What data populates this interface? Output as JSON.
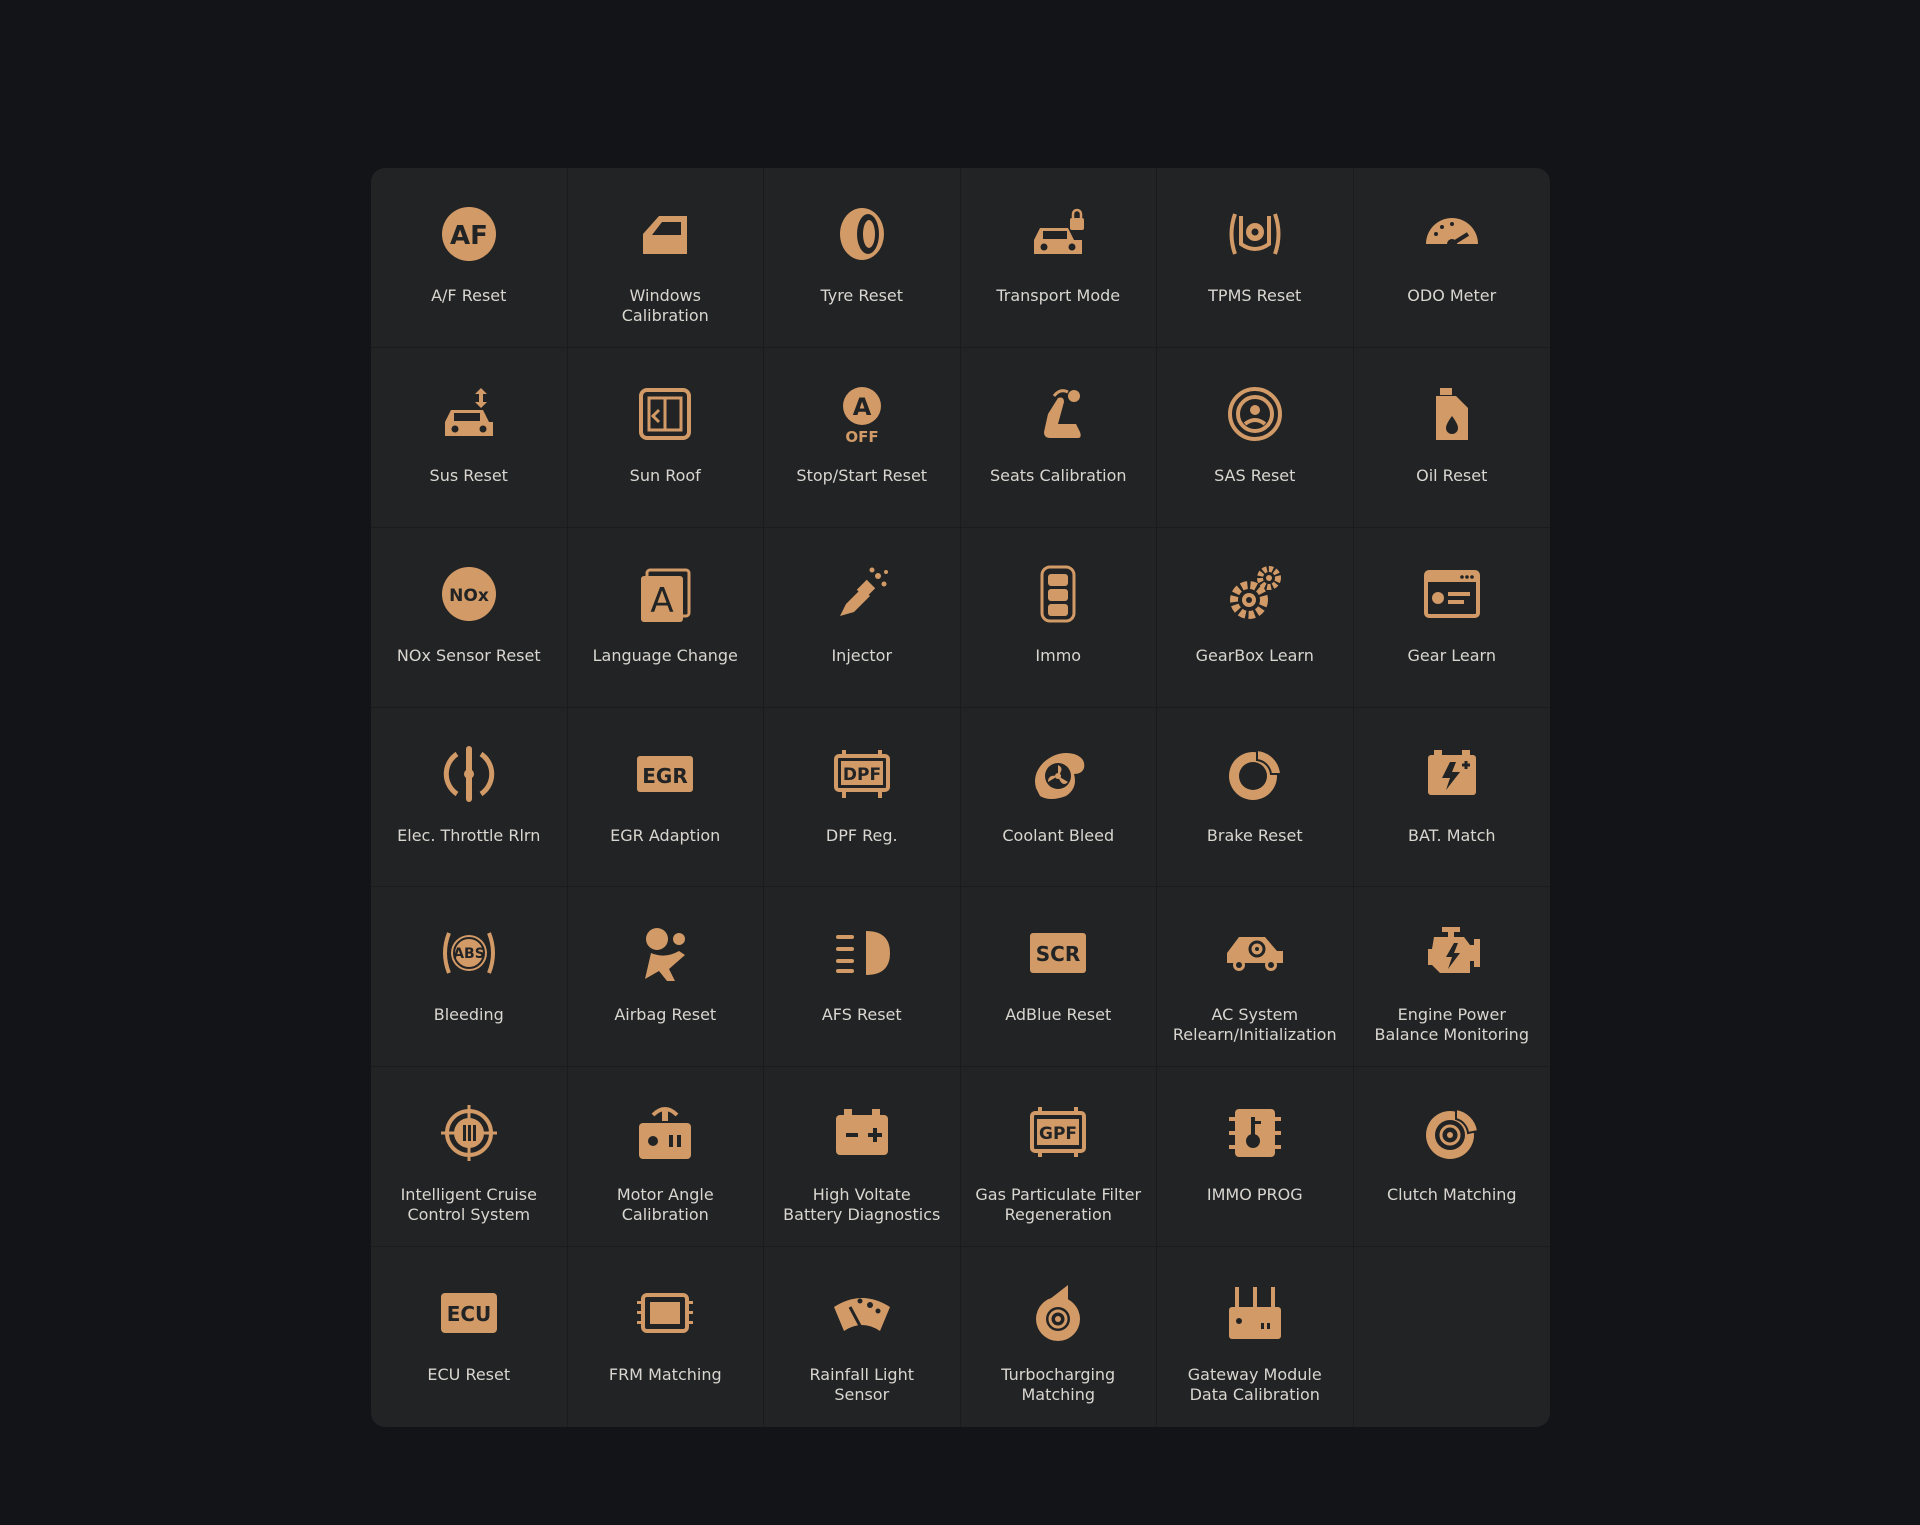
{
  "colors": {
    "background": "#131418",
    "panel": "#222325",
    "icon": "#d19a66",
    "label": "#d9d6d0"
  },
  "tiles": [
    {
      "label": "A/F Reset",
      "icon": "af-icon"
    },
    {
      "label": "Windows\nCalibration",
      "icon": "car-window-icon"
    },
    {
      "label": "Tyre Reset",
      "icon": "tyre-icon"
    },
    {
      "label": "Transport Mode",
      "icon": "car-lock-icon"
    },
    {
      "label": "TPMS Reset",
      "icon": "tpms-icon"
    },
    {
      "label": "ODO Meter",
      "icon": "speedometer-icon"
    },
    {
      "label": "Sus Reset",
      "icon": "car-suspension-icon"
    },
    {
      "label": "Sun Roof",
      "icon": "sunroof-icon"
    },
    {
      "label": "Stop/Start Reset",
      "icon": "auto-off-icon"
    },
    {
      "label": "Seats Calibration",
      "icon": "seat-icon"
    },
    {
      "label": "SAS Reset",
      "icon": "steering-wheel-icon"
    },
    {
      "label": "Oil Reset",
      "icon": "oil-can-icon"
    },
    {
      "label": "NOx Sensor Reset",
      "icon": "nox-icon"
    },
    {
      "label": "Language Change",
      "icon": "language-icon"
    },
    {
      "label": "Injector",
      "icon": "injector-icon"
    },
    {
      "label": "Immo",
      "icon": "key-fob-icon"
    },
    {
      "label": "GearBox Learn",
      "icon": "gears-icon"
    },
    {
      "label": "Gear Learn",
      "icon": "gear-window-icon"
    },
    {
      "label": "Elec. Throttle Rlrn",
      "icon": "throttle-icon"
    },
    {
      "label": "EGR Adaption",
      "icon": "egr-icon"
    },
    {
      "label": "DPF Reg.",
      "icon": "dpf-icon"
    },
    {
      "label": "Coolant Bleed",
      "icon": "coolant-fan-icon"
    },
    {
      "label": "Brake Reset",
      "icon": "brake-disc-icon"
    },
    {
      "label": "BAT. Match",
      "icon": "battery-icon"
    },
    {
      "label": "Bleeding",
      "icon": "abs-icon"
    },
    {
      "label": "Airbag Reset",
      "icon": "airbag-icon"
    },
    {
      "label": "AFS Reset",
      "icon": "headlight-icon"
    },
    {
      "label": "AdBlue Reset",
      "icon": "scr-icon"
    },
    {
      "label": "AC System\nRelearn/Initialization",
      "icon": "car-ac-icon"
    },
    {
      "label": "Engine Power\nBalance Monitoring",
      "icon": "engine-icon"
    },
    {
      "label": "Intelligent Cruise\nControl System",
      "icon": "cruise-control-icon"
    },
    {
      "label": "Motor Angle\nCalibration",
      "icon": "motor-icon"
    },
    {
      "label": "High Voltate\nBattery Diagnostics",
      "icon": "hv-battery-icon"
    },
    {
      "label": "Gas Particulate Filter\nRegeneration",
      "icon": "gpf-icon"
    },
    {
      "label": "IMMO PROG",
      "icon": "chip-icon"
    },
    {
      "label": "Clutch Matching",
      "icon": "clutch-icon"
    },
    {
      "label": "ECU Reset",
      "icon": "ecu-icon"
    },
    {
      "label": "FRM Matching",
      "icon": "frm-module-icon"
    },
    {
      "label": "Rainfall Light\nSensor",
      "icon": "wiper-icon"
    },
    {
      "label": "Turbocharging\nMatching",
      "icon": "turbo-icon"
    },
    {
      "label": "Gateway Module\nData Calibration",
      "icon": "gateway-icon"
    }
  ]
}
